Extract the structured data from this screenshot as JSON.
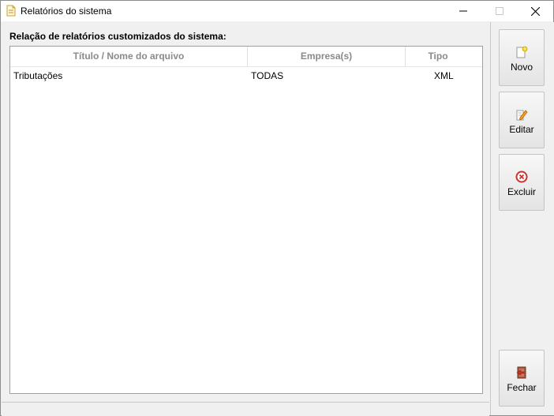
{
  "window": {
    "title": "Relatórios do sistema"
  },
  "list": {
    "caption": "Relação de relatórios customizados do sistema:",
    "columns": [
      "Título / Nome do arquivo",
      "Empresa(s)",
      "Tipo"
    ],
    "rows": [
      {
        "title": "Tributações",
        "company": "TODAS",
        "type": "XML"
      }
    ]
  },
  "actions": {
    "new_label": "Novo",
    "edit_label": "Editar",
    "delete_label": "Excluir",
    "close_label": "Fechar"
  },
  "icons": {
    "app": "document-icon",
    "new": "new-document-icon",
    "edit": "edit-pencil-icon",
    "delete": "delete-circle-icon",
    "close": "exit-door-icon"
  },
  "colors": {
    "delete_accent": "#d0312d",
    "new_accent": "#f2c80f",
    "header_text": "#8a8a8a"
  }
}
